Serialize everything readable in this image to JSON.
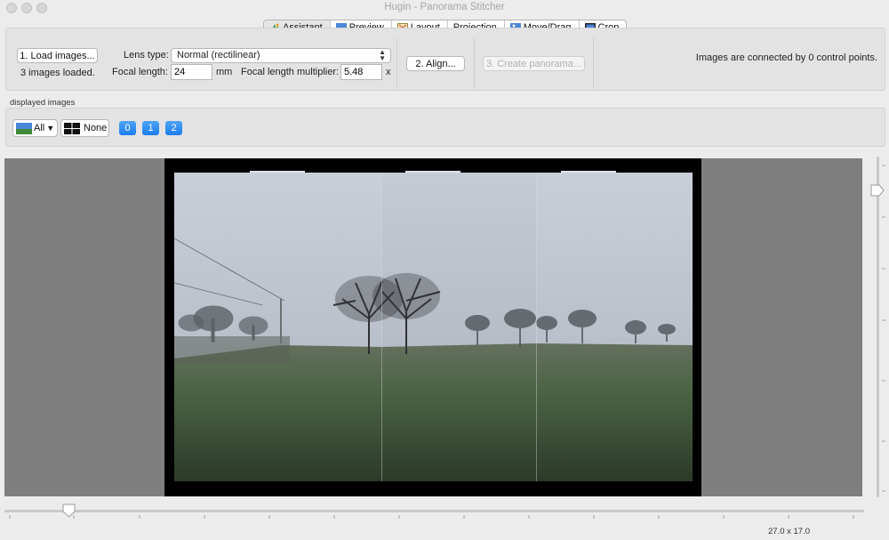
{
  "window": {
    "title": "Hugin - Panorama Stitcher"
  },
  "tabs": [
    {
      "label": "Assistant",
      "icon": "assistant-icon",
      "active": true
    },
    {
      "label": "Preview",
      "icon": "preview-icon"
    },
    {
      "label": "Layout",
      "icon": "layout-icon"
    },
    {
      "label": "Projection"
    },
    {
      "label": "Move/Drag",
      "icon": "move-drag-icon"
    },
    {
      "label": "Crop",
      "icon": "crop-icon"
    }
  ],
  "assistant": {
    "load_button": "1. Load images...",
    "images_loaded": "3 images loaded.",
    "lens_type_label": "Lens type:",
    "lens_type_value": "Normal (rectilinear)",
    "focal_length_label": "Focal length:",
    "focal_length_value": "24",
    "focal_length_unit": "mm",
    "multiplier_label": "Focal length multiplier:",
    "multiplier_value": "5.48",
    "multiplier_unit": "x",
    "align_button": "2. Align...",
    "create_button": "3. Create panorama...",
    "status": "Images are connected by 0 control points."
  },
  "displayed": {
    "label": "displayed images",
    "all_button": "All",
    "none_button": "None",
    "image_buttons": [
      "0",
      "1",
      "2"
    ]
  },
  "footer": {
    "canvas_size": "27.0 x 17.0"
  },
  "colors": {
    "accent": "#1b7df0",
    "canvas_bg": "#7f7f7f",
    "pano_bg": "#000000"
  }
}
